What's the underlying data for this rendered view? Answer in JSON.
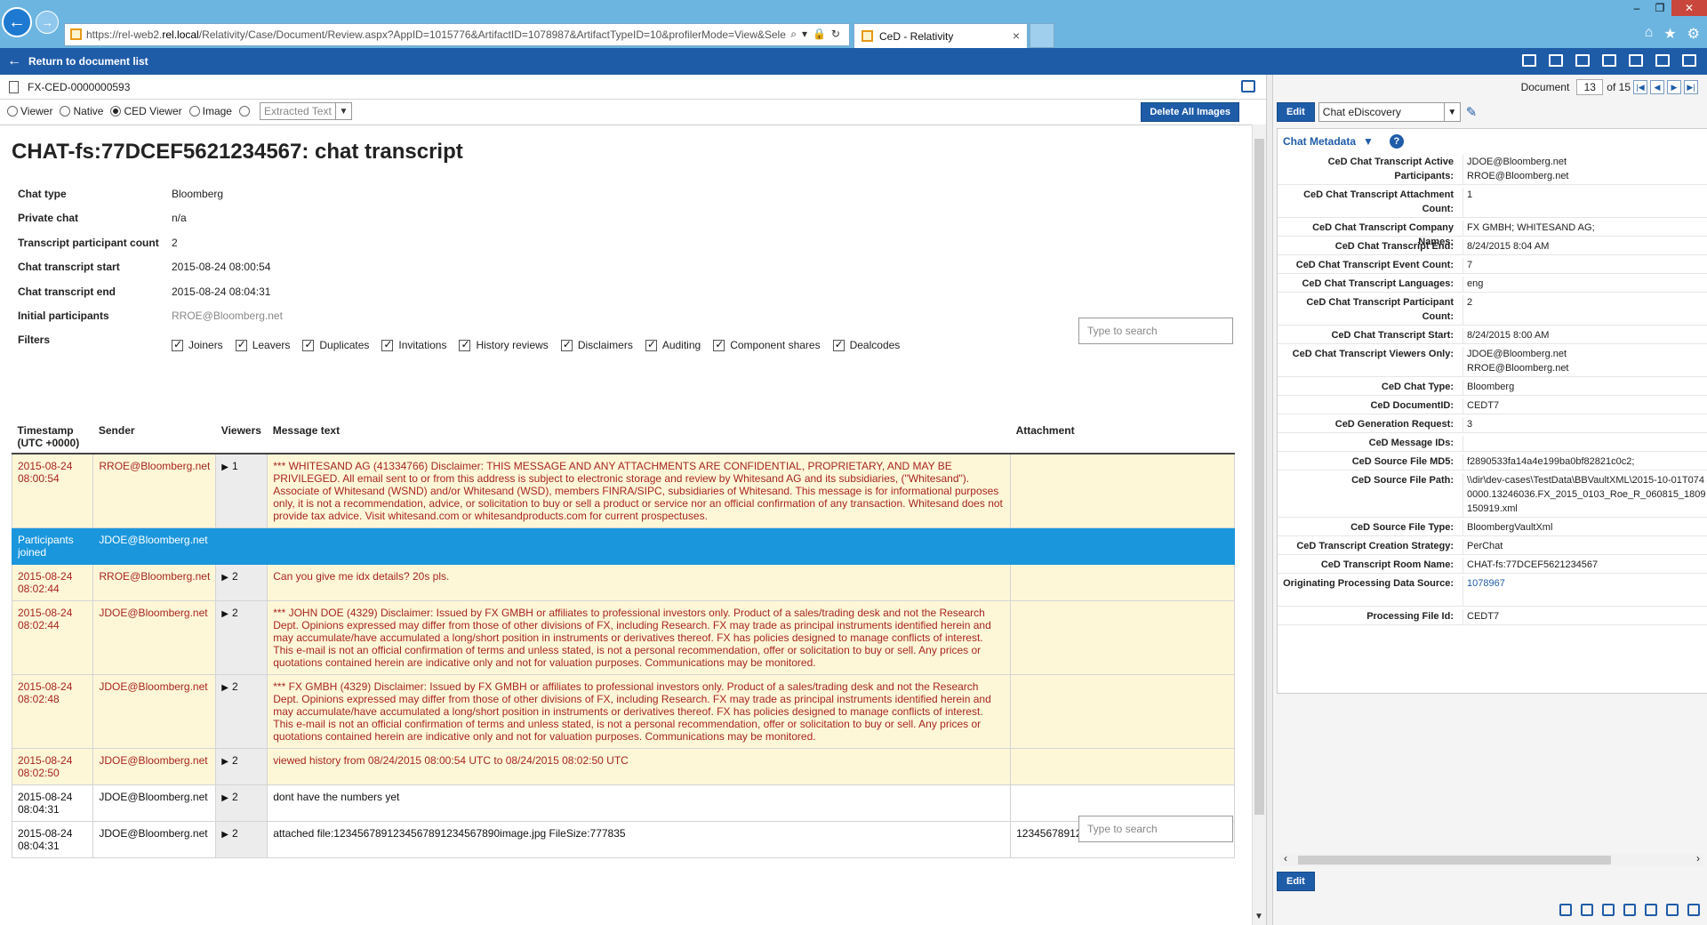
{
  "browser": {
    "url_prefix": "https://rel-web2.",
    "url_host": "rel.local",
    "url_rest": "/Relativity/Case/Document/Review.aspx?AppID=1015776&ArtifactID=1078987&ArtifactTypeID=10&profilerMode=View&Sele",
    "tab_title": "CeD - Relativity"
  },
  "app_bar": {
    "return_label": "Return to document list"
  },
  "document": {
    "control_number": "FX-CED-0000000593",
    "view_modes": [
      "Viewer",
      "Native",
      "CED Viewer",
      "Image"
    ],
    "selected_mode": "CED Viewer",
    "extracted_text_label": "Extracted Text",
    "delete_images_label": "Delete All Images"
  },
  "transcript": {
    "title": "CHAT-fs:77DCEF5621234567: chat transcript",
    "meta": [
      {
        "label": "Chat type",
        "value": "Bloomberg"
      },
      {
        "label": "Private chat",
        "value": "n/a"
      },
      {
        "label": "Transcript participant count",
        "value": "2"
      },
      {
        "label": "Chat transcript start",
        "value": "2015-08-24 08:00:54"
      },
      {
        "label": "Chat transcript end",
        "value": "2015-08-24 08:04:31"
      },
      {
        "label": "Initial participants",
        "value": "RROE@Bloomberg.net"
      }
    ],
    "filters_label": "Filters",
    "filters": [
      "Joiners",
      "Leavers",
      "Duplicates",
      "Invitations",
      "History reviews",
      "Disclaimers",
      "Auditing",
      "Component shares",
      "Dealcodes"
    ],
    "search_placeholder": "Type to search",
    "columns": [
      "Timestamp (UTC +0000)",
      "Sender",
      "Viewers",
      "Message text",
      "Attachment"
    ],
    "rows": [
      {
        "style": "red",
        "timestamp": "2015-08-24 08:00:54",
        "sender": "RROE@Bloomberg.net",
        "viewers": "1",
        "message": "*** WHITESAND AG (41334766) Disclaimer: THIS MESSAGE AND ANY ATTACHMENTS ARE CONFIDENTIAL, PROPRIETARY, AND MAY BE PRIVILEGED. All email sent to or from this address is subject to electronic storage and review by Whitesand AG and its subsidiaries, (\"Whitesand\"). Associate of Whitesand (WSND) and/or Whitesand (WSD), members FINRA/SIPC, subsidiaries of Whitesand. This message is for informational purposes only, it is not a recommendation, advice, or solicitation to buy or sell a product or service nor an official confirmation of any transaction. Whitesand does not provide tax advice. Visit whitesand.com or whitesandproducts.com for current prospectuses.",
        "attachment": ""
      },
      {
        "style": "joined",
        "timestamp": "Participants joined",
        "sender": "JDOE@Bloomberg.net",
        "viewers": "",
        "message": "",
        "attachment": ""
      },
      {
        "style": "red",
        "timestamp": "2015-08-24 08:02:44",
        "sender": "RROE@Bloomberg.net",
        "viewers": "2",
        "message": "Can you give me idx details? 20s pls.",
        "attachment": ""
      },
      {
        "style": "red",
        "timestamp": "2015-08-24 08:02:44",
        "sender": "JDOE@Bloomberg.net",
        "viewers": "2",
        "message": "*** JOHN DOE (4329) Disclaimer: Issued by FX GMBH or affiliates to professional investors only. Product of a sales/trading desk and not the Research Dept. Opinions expressed may differ from those of other divisions of FX, including Research. FX may trade as principal instruments identified herein and may accumulate/have accumulated a long/short position in instruments or derivatives thereof. FX has policies designed to manage conflicts of interest. This e-mail is not an official confirmation of terms and unless stated, is not a personal recommendation, offer or solicitation to buy or sell. Any prices or quotations contained herein are indicative only and not for valuation purposes. Communications may be monitored.",
        "attachment": ""
      },
      {
        "style": "red",
        "timestamp": "2015-08-24 08:02:48",
        "sender": "JDOE@Bloomberg.net",
        "viewers": "2",
        "message": "*** FX GMBH (4329) Disclaimer: Issued by FX GMBH or affiliates to professional investors only. Product of a sales/trading desk and not the Research Dept. Opinions expressed may differ from those of other divisions of FX, including Research. FX may trade as principal instruments identified herein and may accumulate/have accumulated a long/short position in instruments or derivatives thereof. FX has policies designed to manage conflicts of interest. This e-mail is not an official confirmation of terms and unless stated, is not a personal recommendation, offer or solicitation to buy or sell. Any prices or quotations contained herein are indicative only and not for valuation purposes. Communications may be monitored.",
        "attachment": ""
      },
      {
        "style": "red",
        "timestamp": "2015-08-24 08:02:50",
        "sender": "JDOE@Bloomberg.net",
        "viewers": "2",
        "message": "viewed history from 08/24/2015 08:00:54 UTC to 08/24/2015 08:02:50 UTC",
        "attachment": ""
      },
      {
        "style": "plain",
        "timestamp": "2015-08-24 08:04:31",
        "sender": "JDOE@Bloomberg.net",
        "viewers": "2",
        "message": "dont have the numbers yet",
        "attachment": ""
      },
      {
        "style": "plain",
        "timestamp": "2015-08-24 08:04:31",
        "sender": "JDOE@Bloomberg.net",
        "viewers": "2",
        "message": "attached file:1234567891234567891234567890image.jpg FileSize:777835",
        "attachment": "1234567891234567891234567890image.jpg"
      }
    ]
  },
  "pager": {
    "label": "Document",
    "current": "13",
    "of_total": "of 15"
  },
  "layout": {
    "edit_label": "Edit",
    "selected_layout": "Chat eDiscovery"
  },
  "fields": {
    "section_title": "Chat Metadata",
    "items": [
      {
        "label": "CeD Chat Transcript Active Participants:",
        "value": "JDOE@Bloomberg.net\nRROE@Bloomberg.net",
        "link": false
      },
      {
        "label": "CeD Chat Transcript Attachment Count:",
        "value": "1",
        "link": false
      },
      {
        "label": "CeD Chat Transcript Company Names:",
        "value": "FX GMBH; WHITESAND AG;",
        "link": false
      },
      {
        "label": "CeD Chat Transcript End:",
        "value": "8/24/2015 8:04 AM",
        "link": false
      },
      {
        "label": "CeD Chat Transcript Event Count:",
        "value": "7",
        "link": false
      },
      {
        "label": "CeD Chat Transcript Languages:",
        "value": "eng",
        "link": false
      },
      {
        "label": "CeD Chat Transcript Participant Count:",
        "value": "2",
        "link": false
      },
      {
        "label": "CeD Chat Transcript Start:",
        "value": "8/24/2015 8:00 AM",
        "link": false
      },
      {
        "label": "CeD Chat Transcript Viewers Only:",
        "value": "JDOE@Bloomberg.net\nRROE@Bloomberg.net",
        "link": false
      },
      {
        "label": "CeD Chat Type:",
        "value": "Bloomberg",
        "link": false
      },
      {
        "label": "CeD DocumentID:",
        "value": "CEDT7",
        "link": false
      },
      {
        "label": "CeD Generation Request:",
        "value": "3",
        "link": false
      },
      {
        "label": "CeD Message IDs:",
        "value": "",
        "link": false
      },
      {
        "label": "CeD Source File MD5:",
        "value": "f2890533fa14a4e199ba0bf82821c0c2;",
        "link": false
      },
      {
        "label": "CeD Source File Path:",
        "value": "\\\\dir\\dev-cases\\TestData\\BBVaultXML\\2015-10-01T074\n0000.13246036.FX_2015_0103_Roe_R_060815_1809\n150919.xml",
        "link": false
      },
      {
        "label": "CeD Source File Type:",
        "value": "BloombergVaultXml",
        "link": false
      },
      {
        "label": "CeD Transcript Creation Strategy:",
        "value": "PerChat",
        "link": false
      },
      {
        "label": "CeD Transcript Room Name:",
        "value": "CHAT-fs:77DCEF5621234567",
        "link": false
      },
      {
        "label": "Originating Processing Data Source:",
        "value": "1078967",
        "link": true
      },
      {
        "label": "Processing File Id:",
        "value": "CEDT7",
        "link": false
      }
    ]
  },
  "colors": {
    "app_bar": "#1f5ca8",
    "browser_bar": "#6cb5e0",
    "highlight_row": "#fdf7d8",
    "joined_row": "#1a96dc",
    "alert_text": "#a8261e"
  }
}
